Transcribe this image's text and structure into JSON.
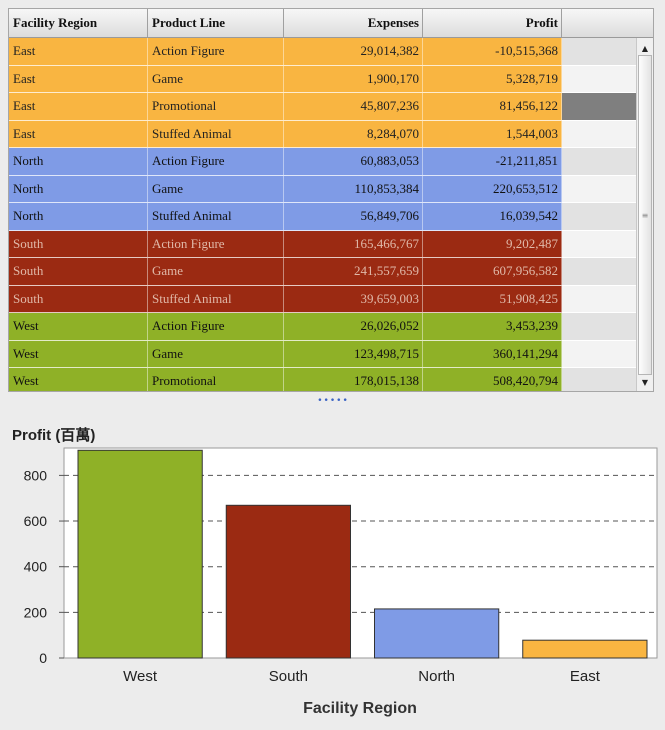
{
  "table": {
    "columns": [
      "Facility Region",
      "Product Line",
      "Expenses",
      "Profit"
    ],
    "rows": [
      {
        "region": "East",
        "product": "Action Figure",
        "expenses": "29,014,382",
        "profit": "-10,515,368"
      },
      {
        "region": "East",
        "product": "Game",
        "expenses": "1,900,170",
        "profit": "5,328,719"
      },
      {
        "region": "East",
        "product": "Promotional",
        "expenses": "45,807,236",
        "profit": "81,456,122"
      },
      {
        "region": "East",
        "product": "Stuffed Animal",
        "expenses": "8,284,070",
        "profit": "1,544,003"
      },
      {
        "region": "North",
        "product": "Action Figure",
        "expenses": "60,883,053",
        "profit": "-21,211,851"
      },
      {
        "region": "North",
        "product": "Game",
        "expenses": "110,853,384",
        "profit": "220,653,512"
      },
      {
        "region": "North",
        "product": "Stuffed Animal",
        "expenses": "56,849,706",
        "profit": "16,039,542"
      },
      {
        "region": "South",
        "product": "Action Figure",
        "expenses": "165,466,767",
        "profit": "9,202,487"
      },
      {
        "region": "South",
        "product": "Game",
        "expenses": "241,557,659",
        "profit": "607,956,582"
      },
      {
        "region": "South",
        "product": "Stuffed Animal",
        "expenses": "39,659,003",
        "profit": "51,908,425"
      },
      {
        "region": "West",
        "product": "Action Figure",
        "expenses": "26,026,052",
        "profit": "3,453,239"
      },
      {
        "region": "West",
        "product": "Game",
        "expenses": "123,498,715",
        "profit": "360,141,294"
      },
      {
        "region": "West",
        "product": "Promotional",
        "expenses": "178,015,138",
        "profit": "508,420,794"
      }
    ]
  },
  "region_colors": {
    "East": "#f9b541",
    "North": "#7f9be6",
    "South": "#9b2a12",
    "West": "#8fb127"
  },
  "region_text_colors": {
    "East": "#222222",
    "North": "#111111",
    "South": "#e0b8a8",
    "West": "#111111"
  },
  "scrollbar": {
    "up_icon": "triangle-up-icon",
    "down_icon": "triangle-down-icon",
    "grip_icon": "grip-icon"
  },
  "chart_data": {
    "type": "bar",
    "title": "Profit (百萬)",
    "xlabel": "Facility Region",
    "ylabel": "",
    "categories": [
      "West",
      "South",
      "North",
      "East"
    ],
    "values": [
      910,
      669,
      215,
      78
    ],
    "colors": [
      "#8fb127",
      "#9b2a12",
      "#7f9be6",
      "#f9b541"
    ],
    "yticks": [
      0,
      200,
      400,
      600,
      800
    ],
    "ylim": [
      0,
      920
    ],
    "grid": true
  }
}
